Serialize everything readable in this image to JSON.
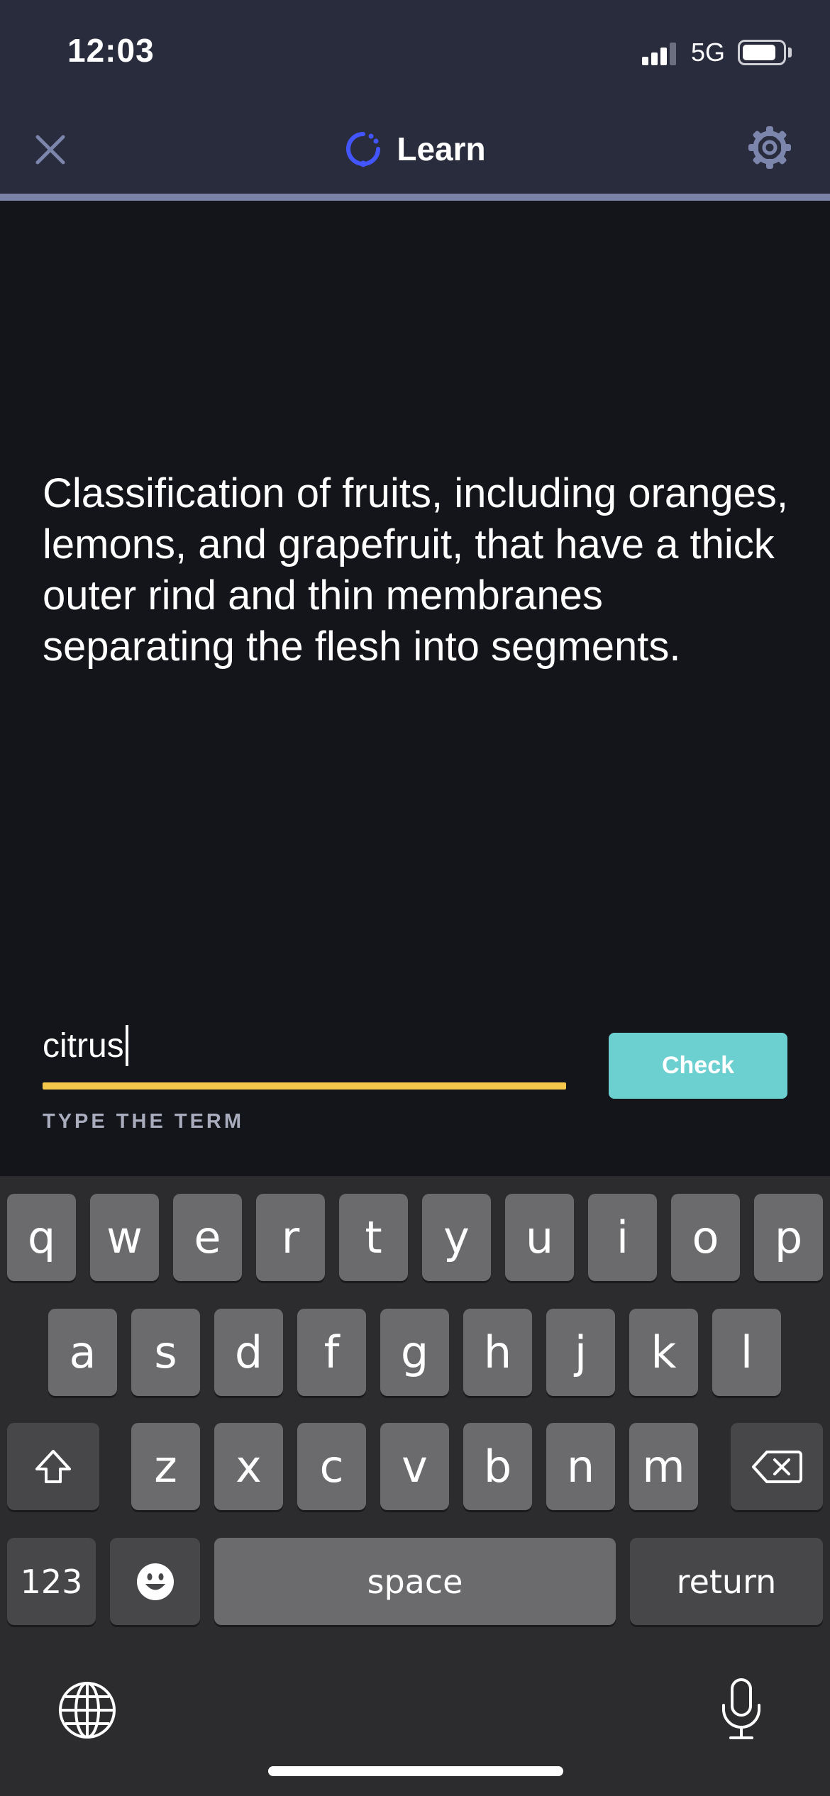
{
  "status_bar": {
    "time": "12:03",
    "network": "5G"
  },
  "header": {
    "title": "Learn",
    "icons": {
      "close": "close-icon",
      "mode": "learn-mode-icon",
      "settings": "gear-icon"
    },
    "progress_fraction": 0.0,
    "colors": {
      "background": "#292c3d",
      "progress_track": "#7b82a8",
      "progress_fill": "#4255ff"
    }
  },
  "question": {
    "prompt": "Classification of fruits, including oranges, lemons, and grapefruit, that have a thick outer rind and thin membranes separating the flesh into segments."
  },
  "answer": {
    "value": "citrus",
    "hint": "TYPE THE TERM",
    "underline_color": "#f5c84b"
  },
  "check_button": {
    "label": "Check",
    "color": "#6ccfd0"
  },
  "keyboard": {
    "row1": [
      "q",
      "w",
      "e",
      "r",
      "t",
      "y",
      "u",
      "i",
      "o",
      "p"
    ],
    "row2": [
      "a",
      "s",
      "d",
      "f",
      "g",
      "h",
      "j",
      "k",
      "l"
    ],
    "row3": [
      "z",
      "x",
      "c",
      "v",
      "b",
      "n",
      "m"
    ],
    "numbers_label": "123",
    "space_label": "space",
    "return_label": "return",
    "icons": {
      "shift": "shift-icon",
      "delete": "delete-icon",
      "emoji": "emoji-icon",
      "globe": "globe-icon",
      "mic": "microphone-icon"
    }
  }
}
